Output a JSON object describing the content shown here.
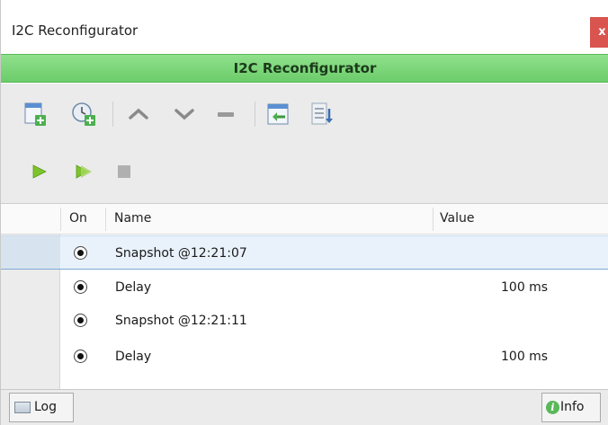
{
  "window": {
    "title": "I2C Reconfigurator",
    "close_label": "x"
  },
  "banner": {
    "title": "I2C Reconfigurator"
  },
  "toolbar": {
    "icons": [
      "add-page-icon",
      "add-clock-icon",
      "chevron-up-icon",
      "chevron-down-icon",
      "minus-icon",
      "import-icon",
      "export-list-icon"
    ]
  },
  "runbar": {
    "icons": [
      "play-icon",
      "play-step-icon",
      "stop-icon"
    ]
  },
  "table": {
    "columns": {
      "on": "On",
      "name": "Name",
      "value": "Value"
    },
    "rows": [
      {
        "name": "Snapshot @12:21:07",
        "value": "",
        "selected": true
      },
      {
        "name": "Delay",
        "value": "100 ms",
        "selected": false
      },
      {
        "name": "Snapshot @12:21:11",
        "value": "",
        "selected": false
      },
      {
        "name": "Delay",
        "value": "100 ms",
        "selected": false
      }
    ]
  },
  "status": {
    "log_label": "Log",
    "info_label": "Info"
  },
  "colors": {
    "banner": "#6ccc6a",
    "close": "#d9534f",
    "play": "#7dc42c",
    "selection": "#e9f2fb"
  }
}
